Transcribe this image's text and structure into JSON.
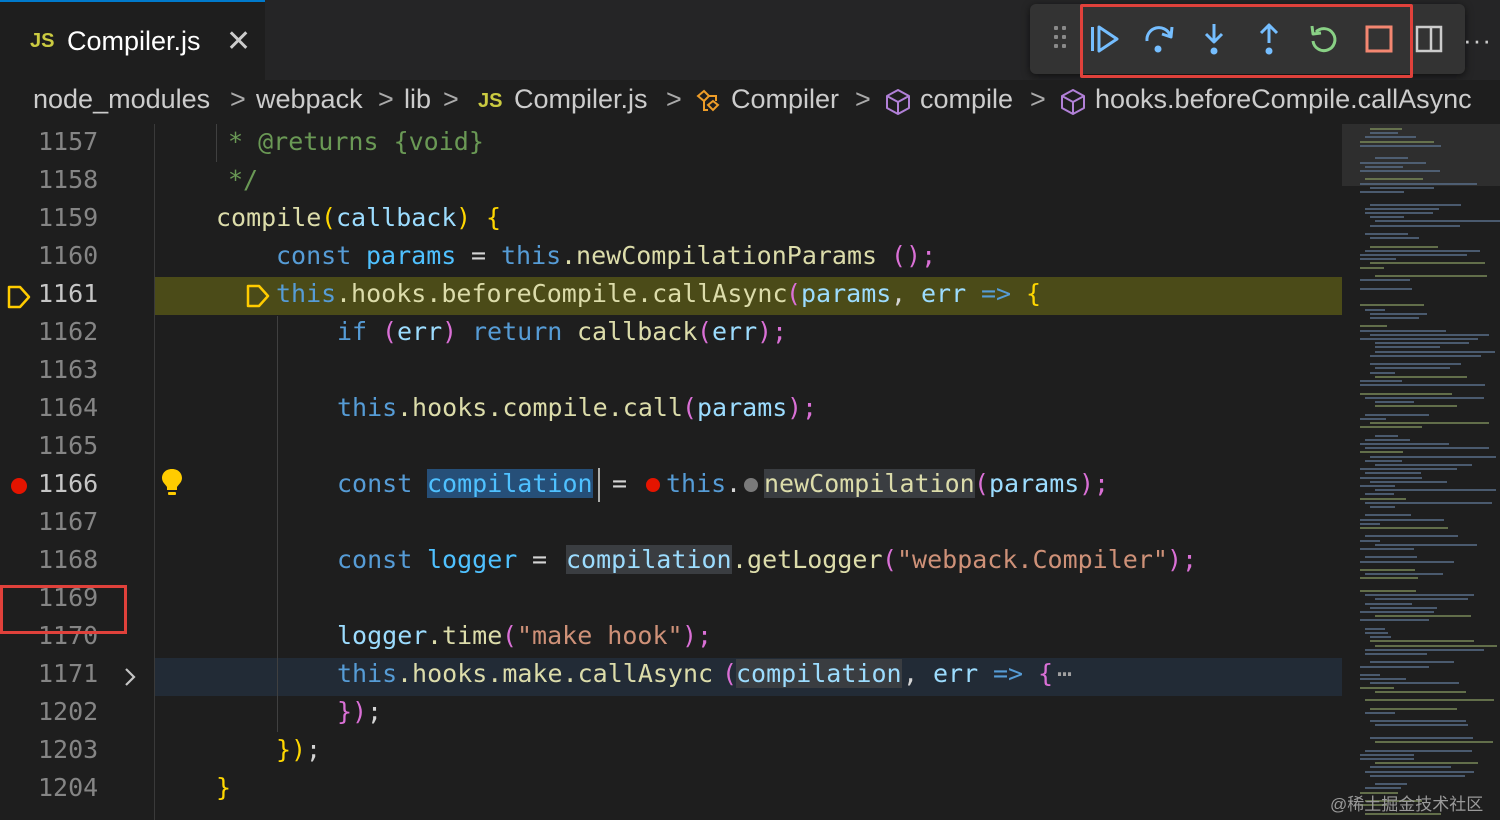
{
  "tab": {
    "lang_badge": "JS",
    "file_name": "Compiler.js",
    "close_glyph": "✕"
  },
  "debug_toolbar": {
    "buttons": [
      {
        "name": "continue",
        "icon": "continue-icon"
      },
      {
        "name": "step-over",
        "icon": "step-over-icon"
      },
      {
        "name": "step-into",
        "icon": "step-into-icon"
      },
      {
        "name": "step-out",
        "icon": "step-out-icon"
      },
      {
        "name": "restart",
        "icon": "restart-icon"
      },
      {
        "name": "stop",
        "icon": "stop-icon"
      }
    ],
    "colors": {
      "blue": "#75beff",
      "green": "#89d185",
      "red": "#f48771"
    }
  },
  "editor_actions": {
    "more_glyph": "···"
  },
  "breadcrumb": {
    "items": [
      {
        "label": "node_modules"
      },
      {
        "label": "webpack"
      },
      {
        "label": "lib"
      },
      {
        "label": "Compiler.js",
        "badge": "JS"
      },
      {
        "label": "Compiler",
        "icon": "class-icon"
      },
      {
        "label": "compile",
        "icon": "method-cube-icon"
      },
      {
        "label": "hooks.beforeCompile.callAsync",
        "icon": "method-cube-icon"
      }
    ],
    "separator": ">"
  },
  "gutter": {
    "line_numbers": [
      "1157",
      "1158",
      "1159",
      "1160",
      "1161",
      "1162",
      "1163",
      "1164",
      "1165",
      "1166",
      "1167",
      "1168",
      "1169",
      "1170",
      "1171",
      "1202",
      "1203",
      "1204"
    ],
    "current_line": "1161",
    "breakpoint_line": "1166",
    "folded_line": "1171"
  },
  "code": {
    "l1157": {
      "a": "* @returns {void}"
    },
    "l1158": {
      "a": "*/"
    },
    "l1159": {
      "a": "compile",
      "b": "(",
      "c": "callback",
      "d": ")",
      "e": " {"
    },
    "l1160": {
      "a": "const",
      "b": "params",
      "c": "=",
      "d": "this",
      "e": ".newCompilationParams",
      "f": "();"
    },
    "l1161": {
      "a": "this",
      "b": ".hooks.beforeCompile.callAsync",
      "c": "(",
      "d": "params",
      "e": ",",
      "f": "err",
      "g": "=>",
      "h": "{"
    },
    "l1162": {
      "a": "if",
      "b": "(",
      "c": "err",
      "d": ")",
      "e": "return",
      "f": "callback",
      "g": "(",
      "h": "err",
      "i": ");"
    },
    "l1164": {
      "a": "this",
      "b": ".hooks.compile.call",
      "c": "(",
      "d": "params",
      "e": ");"
    },
    "l1166": {
      "a": "const",
      "b": "compilation",
      "c": "=",
      "d": "this",
      "e": ".",
      "f": "newCompilation",
      "g": "(",
      "h": "params",
      "i": ");"
    },
    "l1168": {
      "a": "const",
      "b": "logger",
      "c": "=",
      "d": "compilation",
      "e": ".getLogger",
      "f": "(",
      "g": "\"webpack.Compiler\"",
      "h": ");"
    },
    "l1170": {
      "a": "logger",
      "b": ".time",
      "c": "(",
      "d": "\"make hook\"",
      "e": ");"
    },
    "l1171": {
      "a": "this",
      "b": ".hooks.make.callAsync",
      "c": "(",
      "d": "compilation",
      "e": ",",
      "f": "err",
      "g": "=>",
      "h": "{",
      "i": "⋯"
    },
    "l1202": {
      "a": "})",
      "b": ";"
    },
    "l1203": {
      "a": "})",
      "b": ";"
    },
    "l1204": {
      "a": "}"
    }
  },
  "watermark": "@稀土掘金技术社区"
}
